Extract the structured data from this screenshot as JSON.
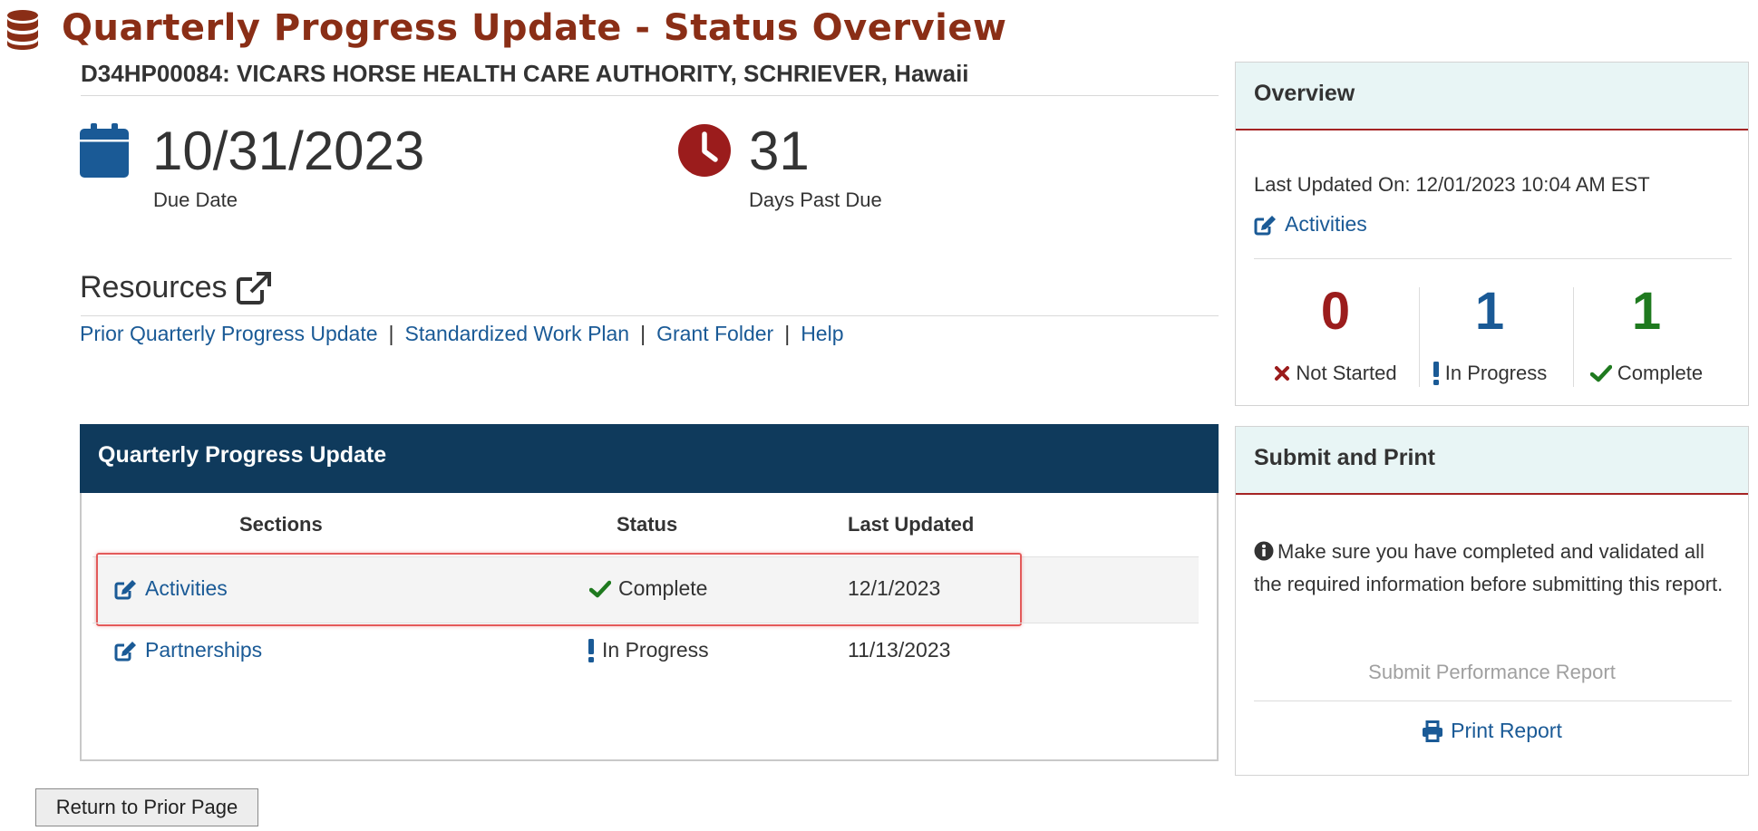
{
  "header": {
    "title": "Quarterly Progress Update - Status Overview",
    "grant_line": "D34HP00084: VICARS HORSE HEALTH CARE AUTHORITY, SCHRIEVER, Hawaii"
  },
  "due": {
    "value": "10/31/2023",
    "label": "Due Date"
  },
  "past_due": {
    "value": "31",
    "label": "Days Past Due"
  },
  "resources": {
    "title": "Resources",
    "links": [
      "Prior Quarterly Progress Update",
      "Standardized Work Plan",
      "Grant Folder",
      "Help"
    ],
    "separator": "|"
  },
  "qpu": {
    "title": "Quarterly Progress Update",
    "columns": [
      "Sections",
      "Status",
      "Last Updated"
    ],
    "rows": [
      {
        "section": "Activities",
        "status": "Complete",
        "status_type": "complete",
        "updated": "12/1/2023"
      },
      {
        "section": "Partnerships",
        "status": "In Progress",
        "status_type": "in-progress",
        "updated": "11/13/2023"
      }
    ]
  },
  "return_button": "Return to Prior Page",
  "overview": {
    "title": "Overview",
    "last_updated": "Last Updated On: 12/01/2023 10:04 AM EST",
    "link": "Activities",
    "stats": [
      {
        "count": "0",
        "label": "Not Started",
        "color": "#9b1c1c",
        "icon": "x-icon"
      },
      {
        "count": "1",
        "label": "In Progress",
        "color": "#1a5a96",
        "icon": "exclamation-icon"
      },
      {
        "count": "1",
        "label": "Complete",
        "color": "#1f7a1f",
        "icon": "check-icon"
      }
    ]
  },
  "submit_print": {
    "title": "Submit and Print",
    "message": "Make sure you have completed and validated all the required information before submitting this report.",
    "submit_label": "Submit Performance Report",
    "print_label": "Print Report"
  },
  "colors": {
    "title": "#8a2e16",
    "link": "#1a5a96",
    "panel_header": "#0f3a5c",
    "card_header_bg": "#e8f5f5",
    "card_header_border": "#a52424",
    "complete": "#1f7a1f",
    "not_started": "#9b1c1c"
  }
}
